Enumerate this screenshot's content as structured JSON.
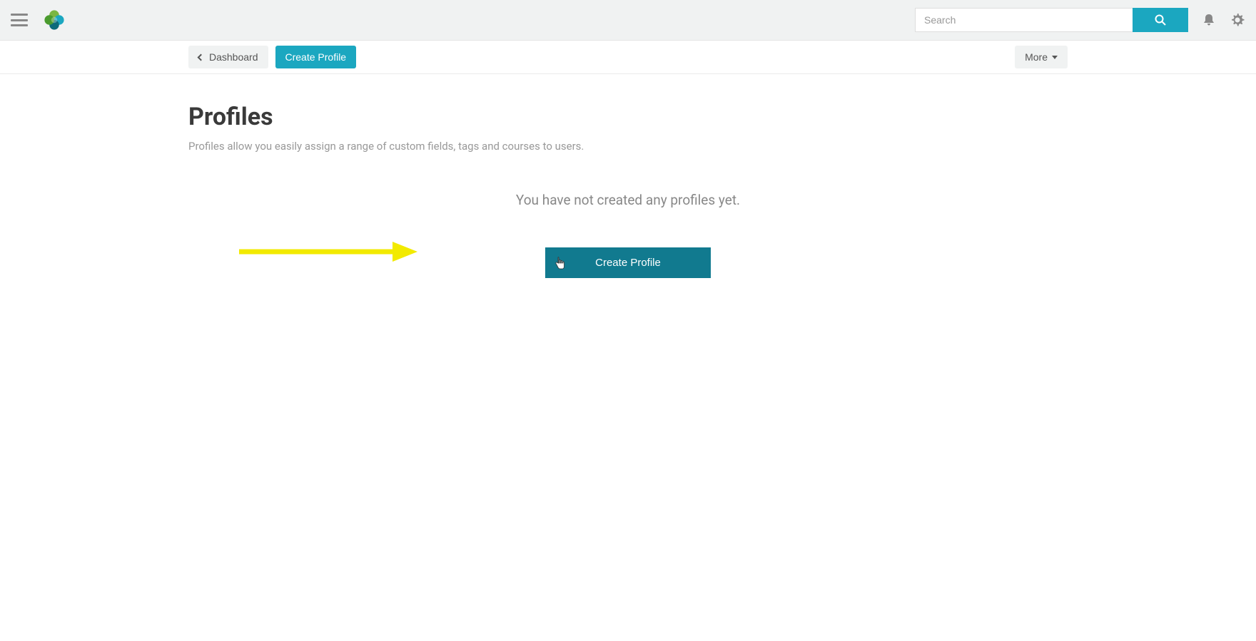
{
  "topbar": {
    "search_placeholder": "Search"
  },
  "subbar": {
    "back_label": "Dashboard",
    "create_label": "Create Profile",
    "more_label": "More"
  },
  "page": {
    "title": "Profiles",
    "subtitle": "Profiles allow you easily assign a range of custom fields, tags and courses to users.",
    "empty_text": "You have not created any profiles yet.",
    "create_button": "Create Profile"
  },
  "colors": {
    "primary": "#1ba7c0",
    "primary_dark": "#117a8f",
    "annotation": "#f2ea00"
  }
}
